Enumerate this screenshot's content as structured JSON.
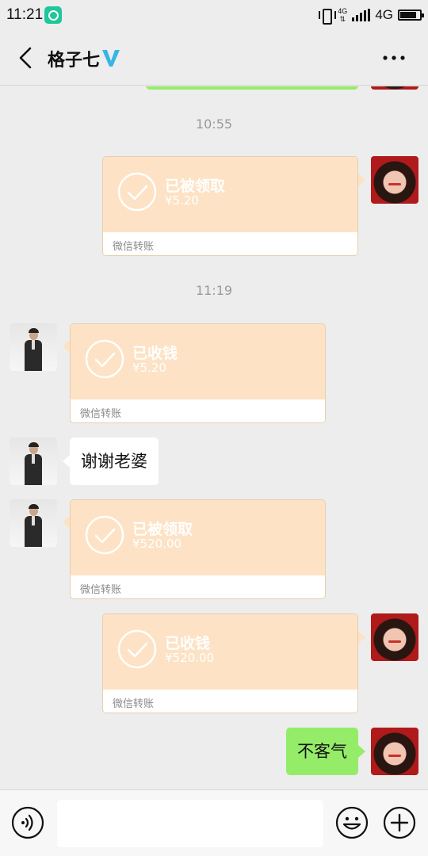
{
  "status_bar": {
    "time": "11:21",
    "network_small": "4G",
    "network": "4G",
    "icons": [
      "app-notification-icon",
      "vibrate-icon",
      "signal-icon",
      "battery-icon"
    ]
  },
  "header": {
    "title": "格子七",
    "icons": [
      "back-icon",
      "verified-icon",
      "more-icon"
    ]
  },
  "colors": {
    "background": "#ededed",
    "card_top": "#fde2c5",
    "sent_bubble": "#95ec69",
    "received_bubble": "#ffffff",
    "verified": "#36b6e5"
  },
  "messages": {
    "timestamp_1": "10:55",
    "timestamp_2": "11:19",
    "t1": {
      "status": "已被领取",
      "amount": "¥5.20",
      "footer": "微信转账"
    },
    "t2": {
      "status": "已收钱",
      "amount": "¥5.20",
      "footer": "微信转账"
    },
    "text_1": "谢谢老婆",
    "t3": {
      "status": "已被领取",
      "amount": "¥520.00",
      "footer": "微信转账"
    },
    "t4": {
      "status": "已收钱",
      "amount": "¥520.00",
      "footer": "微信转账"
    },
    "text_2": "不客气"
  },
  "input_bar": {
    "value": "",
    "icons": [
      "voice-icon",
      "emoji-icon",
      "plus-icon"
    ]
  }
}
